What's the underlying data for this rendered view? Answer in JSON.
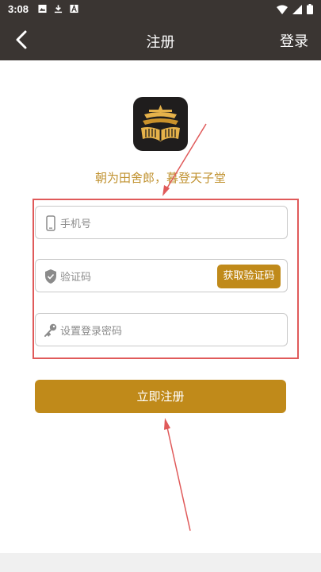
{
  "status_bar": {
    "time": "3:08",
    "left_icons": [
      "image-icon",
      "download-icon",
      "font-icon"
    ],
    "right_icons": [
      "wifi-icon",
      "signal-icon",
      "battery-icon"
    ]
  },
  "app_bar": {
    "title": "注册",
    "back_icon": "chevron-left-icon",
    "login_label": "登录"
  },
  "logo": {
    "icon": "app-logo"
  },
  "slogan": "朝为田舍郎，暮登天子堂",
  "form": {
    "phone": {
      "placeholder": "手机号",
      "icon": "phone-icon"
    },
    "code": {
      "placeholder": "验证码",
      "icon": "shield-icon",
      "button_label": "获取验证码"
    },
    "password": {
      "placeholder": "设置登录密码",
      "icon": "key-icon"
    }
  },
  "register_button_label": "立即注册",
  "colors": {
    "header_bg": "#3a3532",
    "accent": "#c08a1a",
    "slogan": "#c19332",
    "annotation": "#e05a5a"
  }
}
